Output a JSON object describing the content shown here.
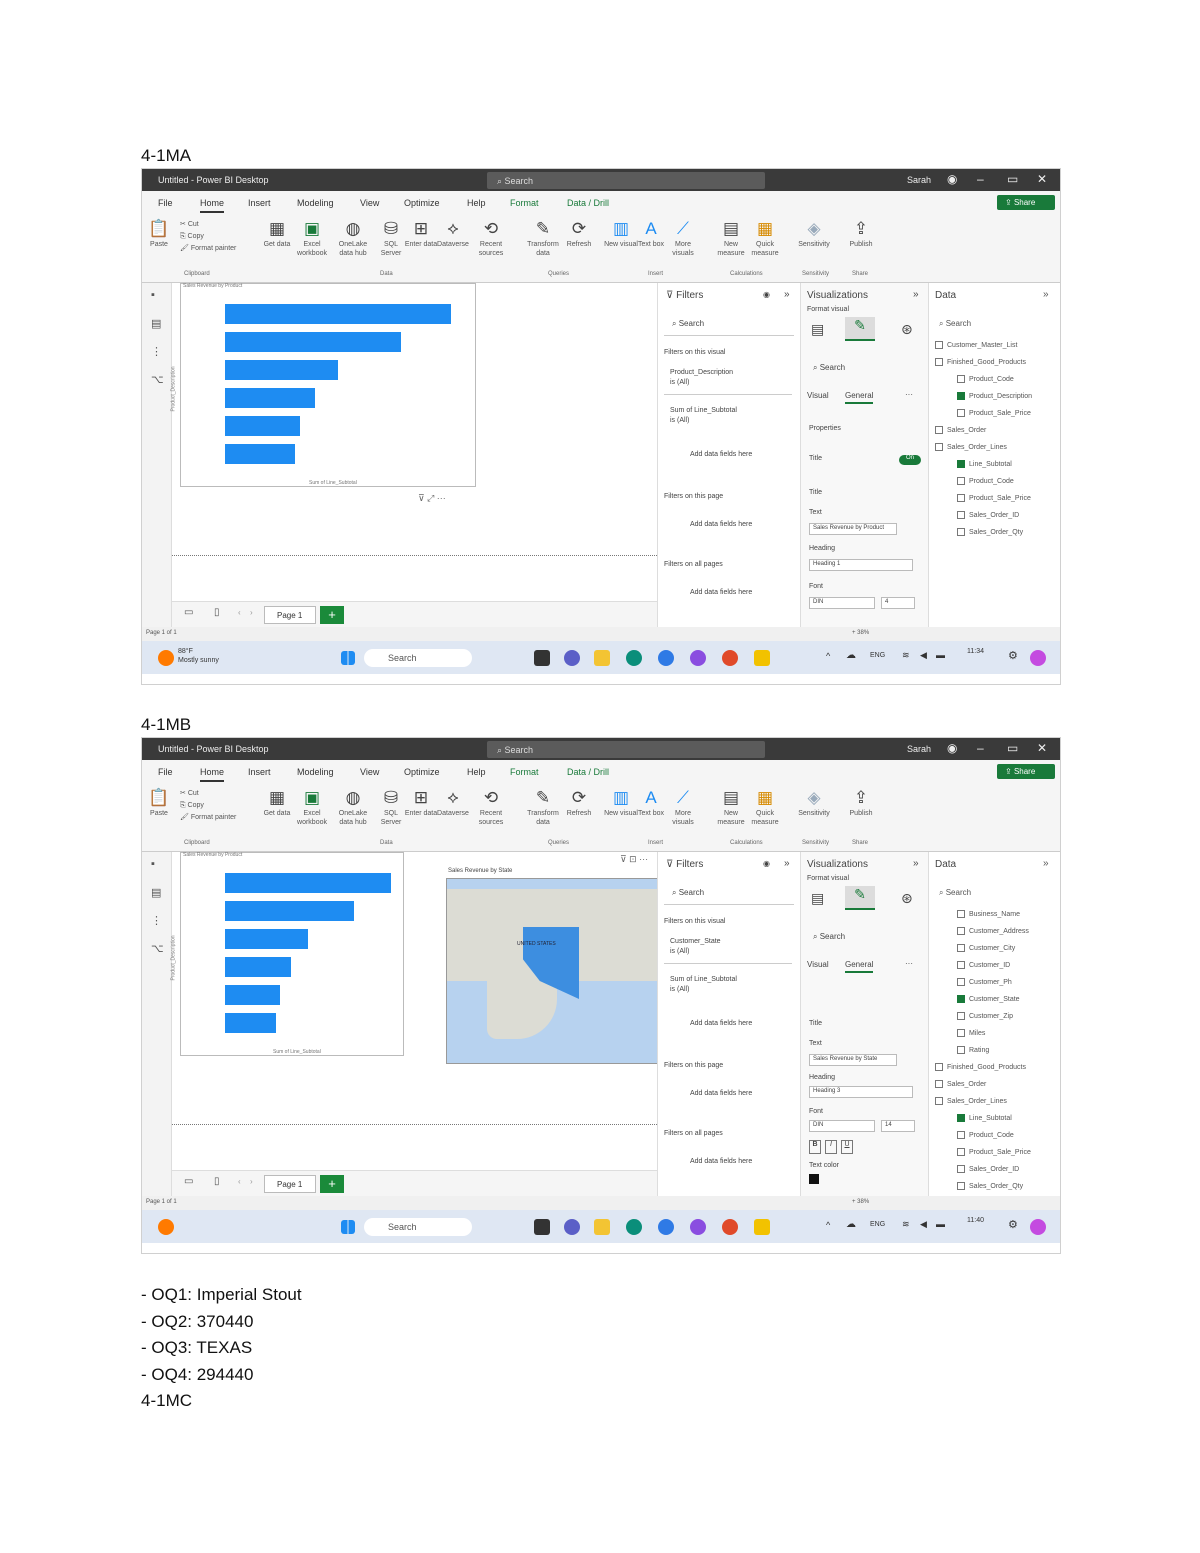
{
  "headings": {
    "ma": "4-1MA",
    "mb": "4-1MB",
    "mc": "4-1MC"
  },
  "answers": {
    "oq1": "- OQ1: Imperial Stout",
    "oq2": "- OQ2: 370440",
    "oq3": "- OQ3: TEXAS",
    "oq4": "- OQ4: 294440"
  },
  "app": {
    "title": "Untitled - Power BI Desktop",
    "search": "Search",
    "user": "Sarah",
    "share": "Share",
    "tabs": [
      "File",
      "Home",
      "Insert",
      "Modeling",
      "View",
      "Optimize",
      "Help",
      "Format",
      "Data / Drill"
    ],
    "ribbon": {
      "cut": "Cut",
      "copy": "Copy",
      "paste": "Paste",
      "format_painter": "Format painter",
      "clipboard": "Clipboard",
      "data": "Data",
      "queries": "Queries",
      "insert": "Insert",
      "calculations": "Calculations",
      "sensitivity": "Sensitivity",
      "share": "Share",
      "get_data": "Get data",
      "excel": "Excel workbook",
      "onelake": "OneLake data hub",
      "sql": "SQL Server",
      "enter_data": "Enter data",
      "dataverse": "Dataverse",
      "recent": "Recent sources",
      "transform": "Transform data",
      "refresh": "Refresh",
      "new_visual": "New visual",
      "text_box": "Text box",
      "more_visuals": "More visuals",
      "new_measure": "New measure",
      "quick_measure": "Quick measure",
      "publish": "Publish"
    },
    "page_tab": "Page 1",
    "page_status": "Page 1 of 1",
    "zoom": "38%",
    "taskbar_search": "Search",
    "weather_temp": "88°F",
    "weather_desc": "Mostly sunny",
    "lang": "ENG",
    "time_a": "11:34",
    "time_b": "11:40"
  },
  "filters": {
    "title": "Filters",
    "search": "Search",
    "on_visual": "Filters on this visual",
    "field_a1": "Product_Description",
    "field_b1": "Customer_State",
    "is_all": "is (All)",
    "field2": "Sum of Line_Subtotal",
    "add_fields": "Add data fields here",
    "on_page": "Filters on this page",
    "on_all": "Filters on all pages"
  },
  "viz": {
    "title": "Visualizations",
    "format_visual": "Format visual",
    "search": "Search",
    "visual": "Visual",
    "general": "General",
    "properties": "Properties",
    "title_toggle": "Title",
    "on": "On",
    "title_section": "Title",
    "text": "Text",
    "text_a": "Sales Revenue by Product",
    "text_b": "Sales Revenue by State",
    "heading": "Heading",
    "heading_a": "Heading 1",
    "heading_b": "Heading 3",
    "font": "Font",
    "font_name": "DIN",
    "font_a": "4",
    "font_b": "14",
    "text_color": "Text color",
    "bold": "B",
    "italic": "I",
    "underline": "U"
  },
  "data_pane": {
    "title": "Data",
    "search": "Search",
    "items_a": [
      "Customer_Master_List",
      "Finished_Good_Products",
      "Product_Code",
      "Product_Description",
      "Product_Sale_Price",
      "Sales_Order",
      "Sales_Order_Lines",
      "Line_Subtotal",
      "Product_Code",
      "Product_Sale_Price",
      "Sales_Order_ID",
      "Sales_Order_Qty"
    ],
    "items_b": [
      "Business_Name",
      "Customer_Address",
      "Customer_City",
      "Customer_ID",
      "Customer_Ph",
      "Customer_State",
      "Customer_Zip",
      "Miles",
      "Rating",
      "Finished_Good_Products",
      "Sales_Order",
      "Sales_Order_Lines",
      "Line_Subtotal",
      "Product_Code",
      "Product_Sale_Price",
      "Sales_Order_ID",
      "Sales_Order_Qty"
    ]
  },
  "charts": {
    "a_title": "Sales Revenue by Product",
    "b_title": "Sales Revenue by Product",
    "map_title": "Sales Revenue by State",
    "map_label": "UNITED STATES",
    "xlabel": "Sum of Line_Subtotal",
    "ylabel": "Product_Description"
  },
  "chart_data": {
    "type": "bar",
    "values": [
      100,
      78,
      50,
      40,
      33,
      31
    ]
  }
}
